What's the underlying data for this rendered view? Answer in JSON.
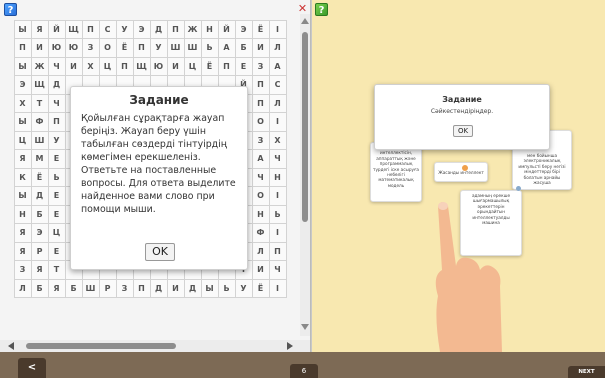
{
  "grid_rows": [
    [
      "Ы",
      "Я",
      "Й",
      "Щ",
      "П",
      "С",
      "У",
      "Э",
      "Д",
      "П",
      "Ж",
      "Н",
      "Й",
      "Э",
      "Ё",
      "І"
    ],
    [
      "П",
      "И",
      "Ю",
      "Ю",
      "З",
      "О",
      "Ё",
      "П",
      "У",
      "Ш",
      "Ш",
      "Ь",
      "А",
      "Б",
      "И",
      "Л"
    ],
    [
      "Ы",
      "Ж",
      "Ч",
      "И",
      "Х",
      "Ц",
      "П",
      "Щ",
      "Ю",
      "И",
      "Ц",
      "Ё",
      "П",
      "Е",
      "З",
      "А"
    ],
    [
      "Э",
      "Щ",
      "Д",
      "",
      "",
      "",
      "",
      "",
      "",
      "",
      "",
      "",
      "",
      "Й",
      "П",
      "С"
    ],
    [
      "Х",
      "Т",
      "Ч",
      "",
      "",
      "",
      "",
      "",
      "",
      "",
      "",
      "",
      "",
      "І",
      "П",
      "Л"
    ],
    [
      "Ы",
      "Ф",
      "П",
      "",
      "",
      "",
      "",
      "",
      "",
      "",
      "",
      "",
      "",
      "М",
      "О",
      "І"
    ],
    [
      "Ц",
      "Ш",
      "У",
      "",
      "",
      "",
      "",
      "",
      "",
      "",
      "",
      "",
      "",
      "Д",
      "З",
      "Х"
    ],
    [
      "Я",
      "М",
      "Е",
      "",
      "",
      "",
      "",
      "",
      "",
      "",
      "",
      "",
      "",
      "Е",
      "А",
      "Ч"
    ],
    [
      "К",
      "Ё",
      "Ь",
      "",
      "",
      "",
      "",
      "",
      "",
      "",
      "",
      "",
      "",
      "П",
      "Ч",
      "Н"
    ],
    [
      "Ы",
      "Д",
      "Е",
      "",
      "",
      "",
      "",
      "",
      "",
      "",
      "",
      "",
      "",
      "",
      "О",
      "І"
    ],
    [
      "Н",
      "Б",
      "Е",
      "",
      "",
      "",
      "",
      "",
      "",
      "",
      "",
      "",
      "",
      "О",
      "Н",
      "Ь"
    ],
    [
      "Я",
      "Э",
      "Ц",
      "",
      "",
      "",
      "",
      "",
      "",
      "",
      "",
      "",
      "",
      "Қ",
      "Ф",
      "І"
    ],
    [
      "Я",
      "Р",
      "Е",
      "",
      "",
      "",
      "",
      "",
      "",
      "",
      "",
      "",
      "",
      "Ы",
      "Л",
      "П"
    ],
    [
      "З",
      "Я",
      "Т",
      "",
      "",
      "",
      "",
      "",
      "",
      "",
      "",
      "",
      "",
      "Т",
      "И",
      "Ч"
    ],
    [
      "Л",
      "Б",
      "Я",
      "Б",
      "Ш",
      "Р",
      "З",
      "П",
      "Д",
      "И",
      "Д",
      "Ы",
      "Ь",
      "У",
      "Ё",
      "І"
    ]
  ],
  "left_dialog": {
    "title": "Задание",
    "body": "Қойылған сұрақтарға жауап беріңіз. Жауап беру үшін табылған сөздерді тінтуірдің көмегімен ерекшеленіз. Ответьте на поставленные вопросы. Для ответа выделите найденное вами слово при помощи мыши.",
    "ok_label": "OK"
  },
  "right_dialog": {
    "title": "Задание",
    "body": "Сәйкестендіріңдер.",
    "ok_label": "OK"
  },
  "cards": {
    "card_1": "Адам ақыл интеллектісін, аппараттық және программалық түрдегі іске асыруға небөлігі математикалық модель",
    "card_2": "Жасанды интеллект",
    "card_3": "мен бойынша электроникалық импульсті беру негізі міндеттерді бірі болатын арнайы жасуша",
    "card_4": "адамның ерекше шығармашылық әрекеттерін орындайтын интеллектуалды машина"
  },
  "nav": {
    "prev_label": "<",
    "page_label": "6",
    "next_label": "NEXT"
  },
  "icons": {
    "help": "?",
    "close": "✕"
  },
  "colors": {
    "right_bg": "#f8e8b0",
    "bottom_bar": "#7d6a55"
  }
}
